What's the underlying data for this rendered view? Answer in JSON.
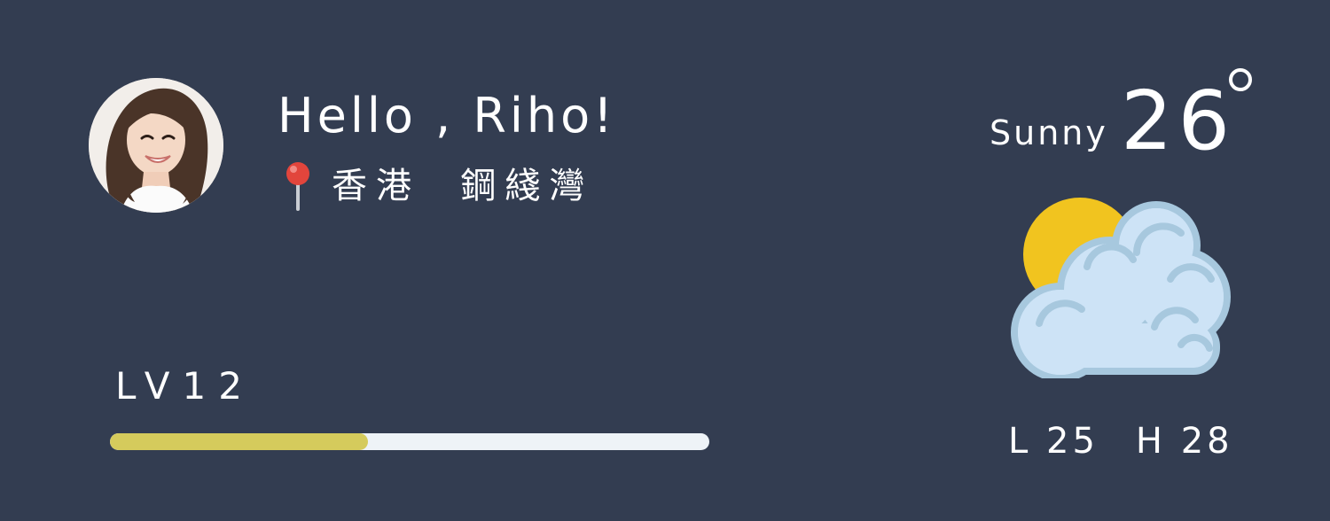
{
  "user": {
    "greeting": "Hello , Riho!",
    "location": "香港  鋼綫灣"
  },
  "level": {
    "label": "LV12",
    "progress": 0.43
  },
  "weather": {
    "condition": "Sunny",
    "temperature": "26",
    "low": "L 25",
    "high": "H 28",
    "icon": "partly-cloudy-icon"
  },
  "colors": {
    "background": "#333d51",
    "progress_fill": "#d5cb5c",
    "progress_track": "#eef3f7",
    "sun": "#f1c41f",
    "cloud": "#cde3f6",
    "cloud_outline": "#a7c8de",
    "pin": "#e2453c"
  }
}
